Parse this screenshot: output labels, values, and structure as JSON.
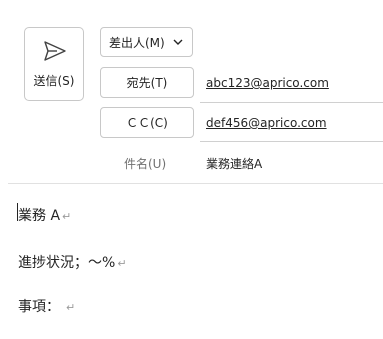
{
  "toolbar": {
    "send_label": "送信(S)",
    "send_icon": "send-icon"
  },
  "from": {
    "label": "差出人(M)",
    "icon": "chevron-down-icon"
  },
  "to": {
    "label": "宛先(T)",
    "value": "abc123@aprico.com"
  },
  "cc": {
    "label": "ＣＣ(C)",
    "value": "def456@aprico.com"
  },
  "subject": {
    "label": "件名(U)",
    "value": "業務連絡A"
  },
  "body": {
    "lines": [
      "業務 A",
      "進捗状況；～%",
      "事項："
    ],
    "paragraph_mark": "↵"
  },
  "colors": {
    "accent": "#242424",
    "border": "#c8c8c8",
    "muted": "#707070"
  }
}
